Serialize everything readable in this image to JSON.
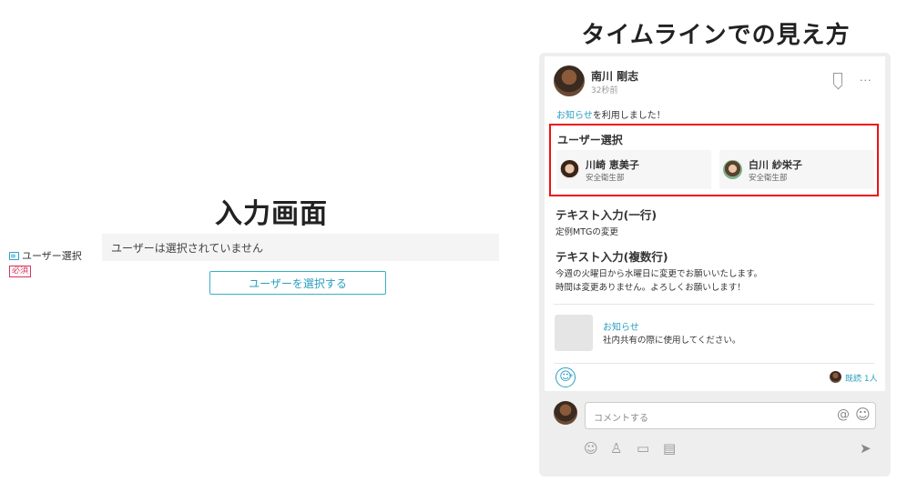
{
  "input_screen": {
    "title": "入力画面",
    "field_label": "ユーザー選択",
    "required_badge": "必須",
    "empty_placeholder": "ユーザーは選択されていません",
    "select_button": "ユーザーを選択する"
  },
  "timeline": {
    "heading": "タイムラインでの見え方",
    "post": {
      "author": "南川 剛志",
      "time": "32秒前",
      "intro_link": "お知らせ",
      "intro_rest": "を利用しました！"
    },
    "user_selection": {
      "label": "ユーザー選択",
      "users": [
        {
          "name": "川崎 恵美子",
          "dept": "安全衛生部"
        },
        {
          "name": "白川 紗栄子",
          "dept": "安全衛生部"
        }
      ]
    },
    "text_single": {
      "label": "テキスト入力(一行)",
      "value": "定例MTGの変更"
    },
    "text_multi": {
      "label": "テキスト入力(複数行)",
      "line1": "今週の火曜日から水曜日に変更でお願いいたします。",
      "line2": "時間は変更ありません。よろしくお願いします！"
    },
    "notice": {
      "title": "お知らせ",
      "desc": "社内共有の際に使用してください。"
    },
    "reaction_icon": "☺",
    "reaction_plus": "+",
    "read": {
      "count": "既読 1人"
    },
    "comment": {
      "placeholder": "コメントする",
      "mention_icon": "@",
      "emoji_icon": "☺"
    },
    "toolbar": {
      "emoji": "☺",
      "stamp": "♙",
      "image": "▭",
      "file": "▤",
      "send": "➤"
    },
    "more_icon": "···"
  },
  "colors": {
    "accent": "#2a9fc0",
    "highlight": "#ee1111",
    "required": "#d9335d"
  }
}
